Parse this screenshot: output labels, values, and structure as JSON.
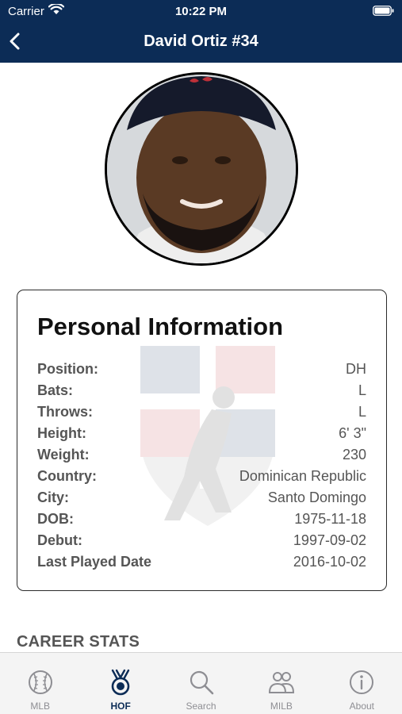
{
  "status": {
    "carrier": "Carrier",
    "time": "10:22 PM"
  },
  "nav": {
    "title": "David Ortiz #34",
    "back_icon": "chevron-left-icon"
  },
  "colors": {
    "primary": "#0c2c56",
    "red": "#bd3039"
  },
  "card": {
    "title": "Personal Information",
    "rows": [
      {
        "label": "Position:",
        "value": "DH"
      },
      {
        "label": "Bats:",
        "value": "L"
      },
      {
        "label": "Throws:",
        "value": "L"
      },
      {
        "label": "Height:",
        "value": "6' 3\""
      },
      {
        "label": "Weight:",
        "value": "230"
      },
      {
        "label": "Country:",
        "value": "Dominican Republic"
      },
      {
        "label": "City:",
        "value": "Santo Domingo"
      },
      {
        "label": "DOB:",
        "value": "1975-11-18"
      },
      {
        "label": "Debut:",
        "value": "1997-09-02"
      },
      {
        "label": "Last Played Date",
        "value": "2016-10-02"
      }
    ]
  },
  "section": {
    "career_stats": "CAREER STATS"
  },
  "tabs": [
    {
      "label": "MLB",
      "icon": "baseball-icon",
      "active": false
    },
    {
      "label": "HOF",
      "icon": "medal-icon",
      "active": true
    },
    {
      "label": "Search",
      "icon": "search-icon",
      "active": false
    },
    {
      "label": "MILB",
      "icon": "people-icon",
      "active": false
    },
    {
      "label": "About",
      "icon": "info-icon",
      "active": false
    }
  ]
}
